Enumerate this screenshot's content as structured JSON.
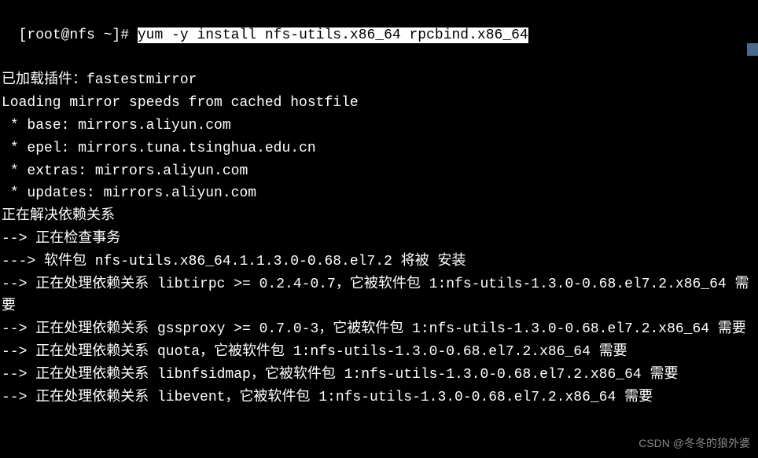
{
  "prompt": "[root@nfs ~]# ",
  "command": "yum -y install nfs-utils.x86_64 rpcbind.x86_64",
  "lines": [
    "已加载插件：fastestmirror",
    "Loading mirror speeds from cached hostfile",
    " * base: mirrors.aliyun.com",
    " * epel: mirrors.tuna.tsinghua.edu.cn",
    " * extras: mirrors.aliyun.com",
    " * updates: mirrors.aliyun.com",
    "正在解决依赖关系",
    "--> 正在检查事务",
    "---> 软件包 nfs-utils.x86_64.1.1.3.0-0.68.el7.2 将被 安装",
    "--> 正在处理依赖关系 libtirpc >= 0.2.4-0.7，它被软件包 1:nfs-utils-1.3.0-0.68.el7.2.x86_64 需要",
    "--> 正在处理依赖关系 gssproxy >= 0.7.0-3，它被软件包 1:nfs-utils-1.3.0-0.68.el7.2.x86_64 需要",
    "--> 正在处理依赖关系 quota，它被软件包 1:nfs-utils-1.3.0-0.68.el7.2.x86_64 需要",
    "--> 正在处理依赖关系 libnfsidmap，它被软件包 1:nfs-utils-1.3.0-0.68.el7.2.x86_64 需要",
    "--> 正在处理依赖关系 libevent，它被软件包 1:nfs-utils-1.3.0-0.68.el7.2.x86_64 需要"
  ],
  "watermark": "CSDN @冬冬的狼外婆"
}
